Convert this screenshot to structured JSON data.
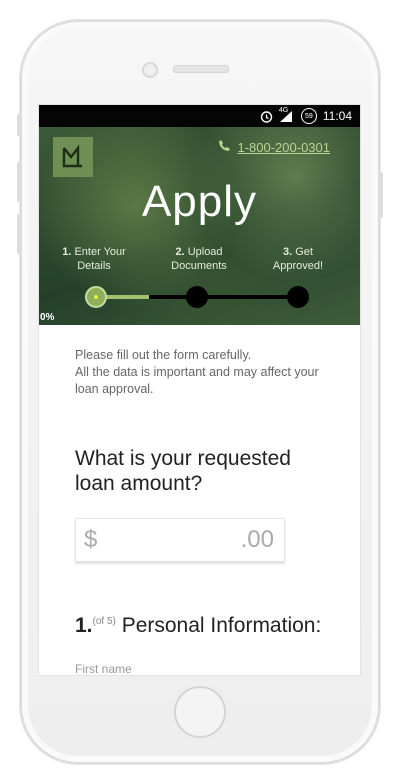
{
  "status_bar": {
    "network": "4G",
    "badge": "59",
    "time": "11:04"
  },
  "header": {
    "logo_text": "LM",
    "phone": "1-800-200-0301",
    "title": "Apply"
  },
  "steps": [
    {
      "number": "1.",
      "label": "Enter Your",
      "label2": "Details"
    },
    {
      "number": "2.",
      "label": "Upload",
      "label2": "Documents"
    },
    {
      "number": "3.",
      "label": "Get",
      "label2": "Approved!"
    }
  ],
  "progress": {
    "percent_text": "0%",
    "active_step": 1
  },
  "intro": {
    "line1": "Please fill out the form carefully.",
    "line2": "All the data is important and may affect your loan approval."
  },
  "loan": {
    "question": "What is your requested loan amount?",
    "currency": "$",
    "cents": ".00"
  },
  "section": {
    "number": "1.",
    "of": "(of 5)",
    "title": "Personal Information:"
  },
  "fields": {
    "first_name_label": "First name"
  }
}
